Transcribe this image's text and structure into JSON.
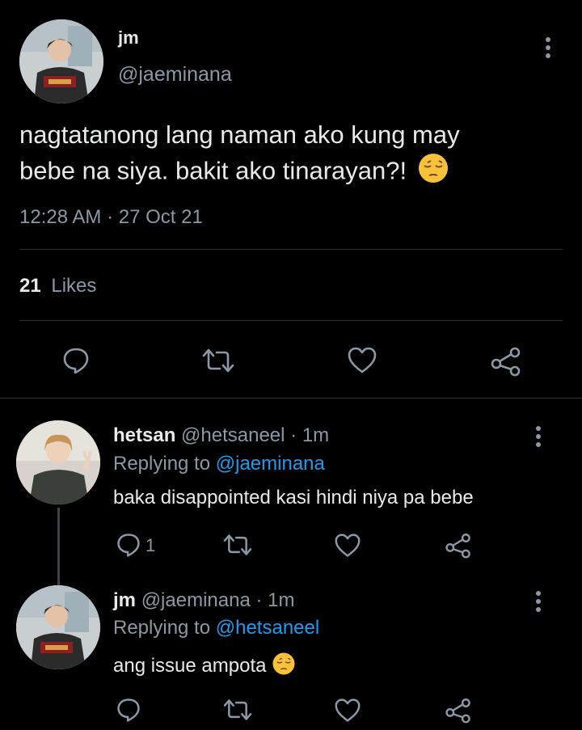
{
  "main_tweet": {
    "display_name": "jm",
    "handle": "@jaeminana",
    "text_line1": "nagtatanong lang naman ako kung may",
    "text_line2": "bebe na siya. bakit ako tinarayan?!",
    "emoji": "pensive-face",
    "timestamp": "12:28 AM · 27 Oct 21",
    "likes_count": "21",
    "likes_label": "Likes"
  },
  "replies": [
    {
      "display_name": "hetsan",
      "handle": "@hetsaneel",
      "time": "· 1m",
      "replying_prefix": "Replying to",
      "replying_to": "@jaeminana",
      "text": "baka disappointed kasi hindi niya pa bebe",
      "reply_count": "1"
    },
    {
      "display_name": "jm",
      "handle": "@jaeminana",
      "time": "· 1m",
      "replying_prefix": "Replying to",
      "replying_to": "@hetsaneel",
      "text": "ang issue ampota",
      "emoji": "pensive-face",
      "reply_count": ""
    }
  ],
  "colors": {
    "background": "#000000",
    "text": "#e7e9ea",
    "muted": "#8b98a5",
    "link": "#1d9bf0",
    "divider": "#2f3336"
  }
}
